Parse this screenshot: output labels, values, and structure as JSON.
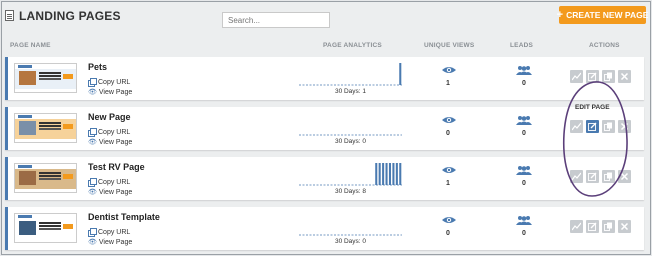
{
  "header": {
    "title": "LANDING PAGES",
    "search_placeholder": "Search...",
    "create_label": "CREATE NEW PAGE",
    "create_plus": "+"
  },
  "columns": {
    "page_name": "PAGE NAME",
    "page_analytics": "PAGE ANALYTICS",
    "unique_views": "UNIQUE VIEWS",
    "leads": "LEADS",
    "actions": "ACTIONS"
  },
  "links": {
    "copy_url": "Copy URL",
    "view_page": "View Page"
  },
  "tooltip": "EDIT PAGE",
  "colors": {
    "accent": "#4a7ab0",
    "create_button": "#f39a1d",
    "action_button": "#c7cbcf",
    "annotation": "#5b3f7a"
  },
  "rows": [
    {
      "name": "Pets",
      "days_label": "30 Days: 1",
      "views": "1",
      "leads": "0",
      "daily_views": [
        0,
        0,
        0,
        0,
        0,
        0,
        0,
        0,
        0,
        0,
        0,
        0,
        0,
        0,
        0,
        0,
        0,
        0,
        0,
        0,
        0,
        0,
        0,
        0,
        0,
        0,
        0,
        0,
        0,
        1
      ],
      "thumb_colors": [
        "#e9f0f7",
        "#b5763f"
      ],
      "edit_active": false
    },
    {
      "name": "New Page",
      "days_label": "30 Days: 0",
      "views": "0",
      "leads": "0",
      "daily_views": [
        0,
        0,
        0,
        0,
        0,
        0,
        0,
        0,
        0,
        0,
        0,
        0,
        0,
        0,
        0,
        0,
        0,
        0,
        0,
        0,
        0,
        0,
        0,
        0,
        0,
        0,
        0,
        0,
        0,
        0
      ],
      "thumb_colors": [
        "#f6d29a",
        "#7a8fa8"
      ],
      "edit_active": true
    },
    {
      "name": "Test RV Page",
      "days_label": "30 Days: 8",
      "views": "1",
      "leads": "0",
      "daily_views": [
        0,
        0,
        0,
        0,
        0,
        0,
        0,
        0,
        0,
        0,
        0,
        0,
        0,
        0,
        0,
        0,
        0,
        0,
        0,
        0,
        0,
        0,
        1,
        1,
        1,
        1,
        1,
        1,
        1,
        1
      ],
      "thumb_colors": [
        "#d9b98a",
        "#9b6b45"
      ],
      "edit_active": false
    },
    {
      "name": "Dentist Template",
      "days_label": "30 Days: 0",
      "views": "0",
      "leads": "0",
      "daily_views": [
        0,
        0,
        0,
        0,
        0,
        0,
        0,
        0,
        0,
        0,
        0,
        0,
        0,
        0,
        0,
        0,
        0,
        0,
        0,
        0,
        0,
        0,
        0,
        0,
        0,
        0,
        0,
        0,
        0,
        0
      ],
      "thumb_colors": [
        "#ffffff",
        "#3b5d80"
      ],
      "edit_active": false
    }
  ],
  "icons": {
    "analytics": "chart-icon",
    "edit": "pencil-icon",
    "duplicate": "copy-icon",
    "delete": "close-icon"
  }
}
